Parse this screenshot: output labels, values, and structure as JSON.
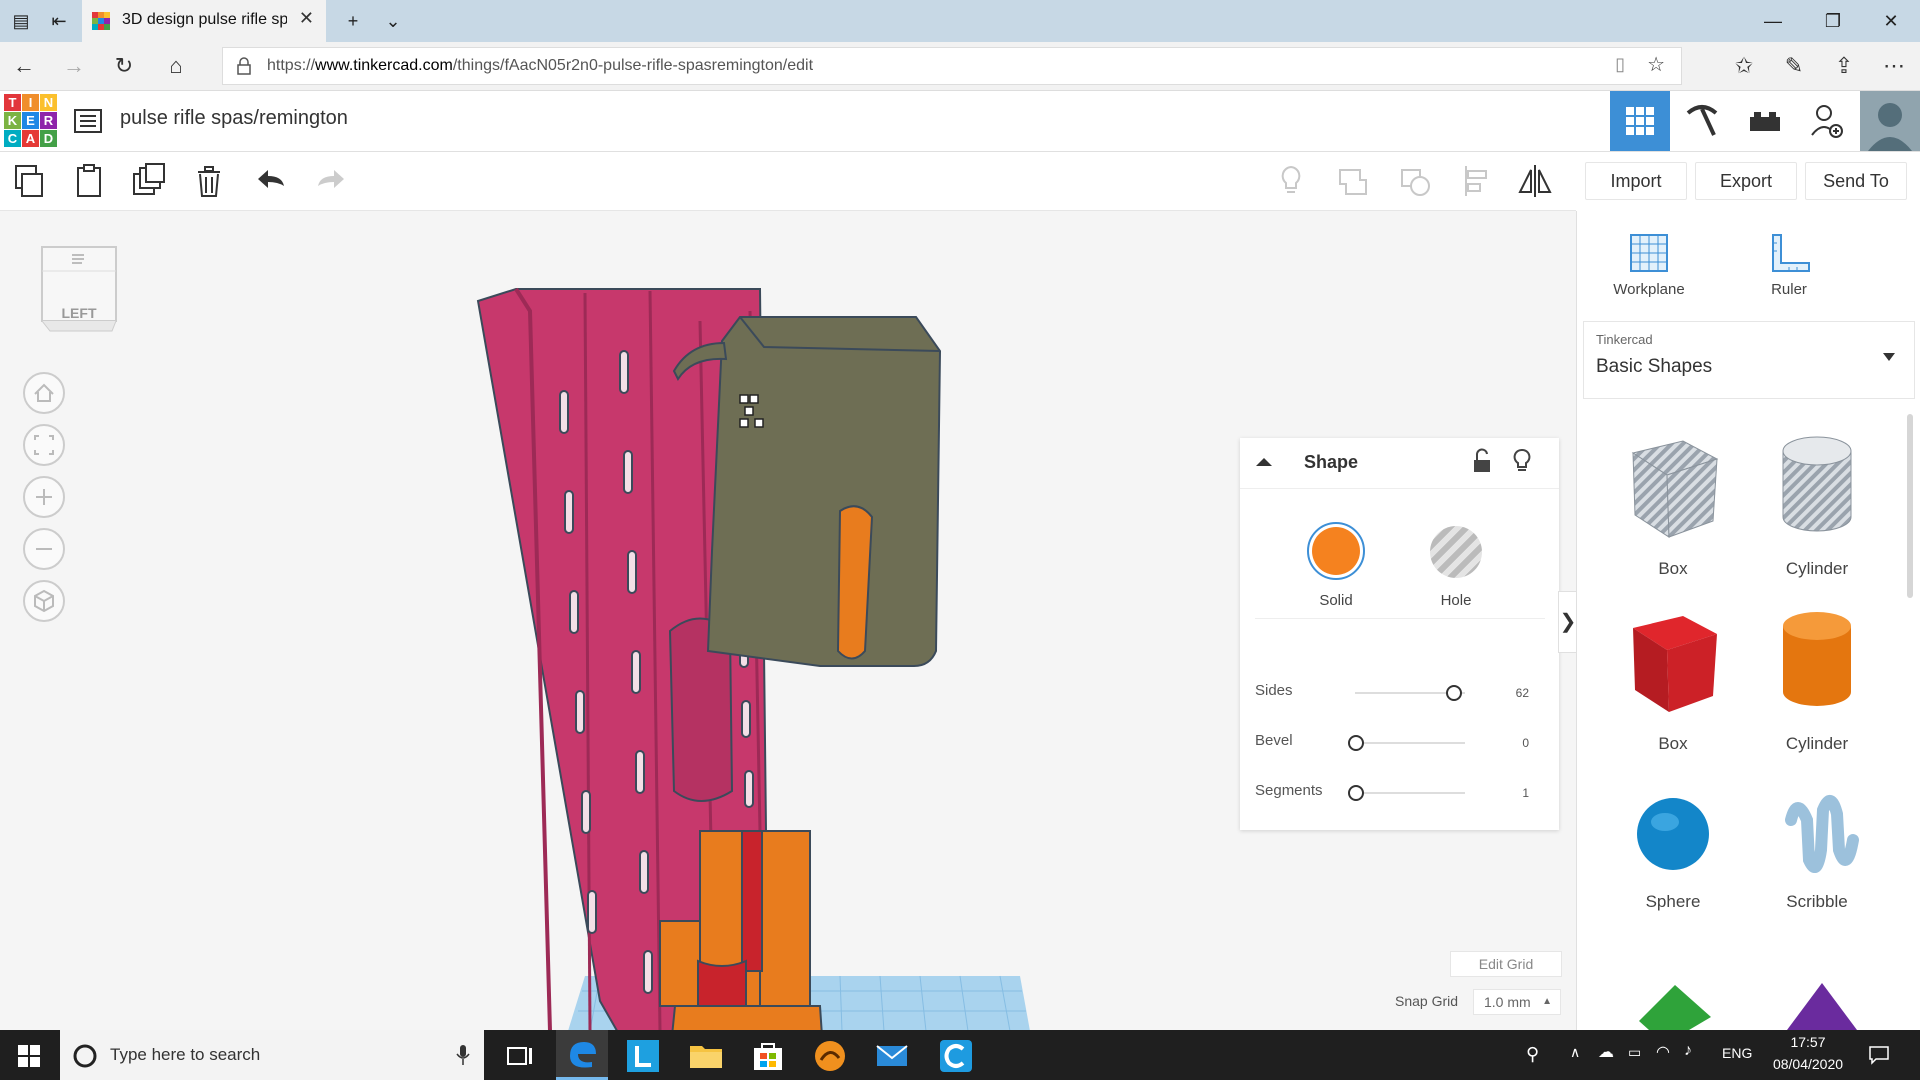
{
  "browser": {
    "tab_title": "3D design pulse rifle sp",
    "url_prefix": "https://",
    "url_domain": "www.tinkercad.com",
    "url_path": "/things/fAacN05r2n0-pulse-rifle-spasremington/edit"
  },
  "app": {
    "logo_letters": [
      "T",
      "I",
      "N",
      "K",
      "E",
      "R",
      "C",
      "A",
      "D"
    ],
    "design_title": "pulse rifle spas/remington"
  },
  "toolbar": {
    "import_label": "Import",
    "export_label": "Export",
    "send_to_label": "Send To"
  },
  "viewcube": {
    "face_label": "LEFT"
  },
  "inspector": {
    "title": "Shape",
    "solid_label": "Solid",
    "hole_label": "Hole",
    "params": [
      {
        "label": "Sides",
        "value": "62",
        "fraction": 0.83
      },
      {
        "label": "Bevel",
        "value": "0",
        "fraction": 0.0
      },
      {
        "label": "Segments",
        "value": "1",
        "fraction": 0.0
      }
    ]
  },
  "grid": {
    "edit_grid_label": "Edit Grid",
    "snap_grid_label": "Snap Grid",
    "snap_grid_value": "1.0 mm"
  },
  "right_panel": {
    "workplane_label": "Workplane",
    "ruler_label": "Ruler",
    "library_source": "Tinkercad",
    "library_name": "Basic Shapes",
    "shapes": [
      {
        "label": "Box",
        "icon": "striped-box-icon"
      },
      {
        "label": "Cylinder",
        "icon": "striped-cylinder-icon"
      },
      {
        "label": "Box",
        "icon": "red-box-icon"
      },
      {
        "label": "Cylinder",
        "icon": "orange-cylinder-icon"
      },
      {
        "label": "Sphere",
        "icon": "blue-sphere-icon"
      },
      {
        "label": "Scribble",
        "icon": "scribble-icon"
      }
    ]
  },
  "taskbar": {
    "search_placeholder": "Type here to search",
    "language": "ENG",
    "time": "17:57",
    "date": "08/04/2020"
  },
  "colors": {
    "accent_blue": "#3d8fd6",
    "solid_orange": "#f5821f",
    "model_pink": "#c7386c",
    "model_olive": "#6e6e54",
    "model_orange": "#e87c1e"
  }
}
